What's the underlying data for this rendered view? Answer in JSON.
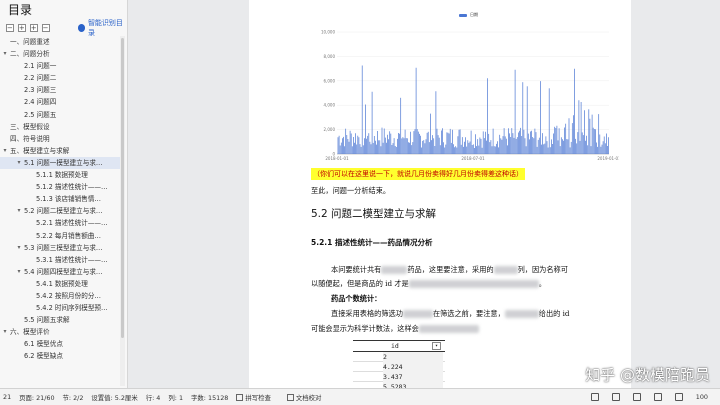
{
  "toc": {
    "title": "目录",
    "smart_toc_label": "智能识别目录",
    "items": [
      {
        "label": "一、问题重述",
        "level": 1,
        "arrow": ""
      },
      {
        "label": "二、问题分析",
        "level": 1,
        "arrow": "▾"
      },
      {
        "label": "2.1 问题一",
        "level": 2,
        "arrow": ""
      },
      {
        "label": "2.2 问题二",
        "level": 2,
        "arrow": ""
      },
      {
        "label": "2.3 问题三",
        "level": 2,
        "arrow": ""
      },
      {
        "label": "2.4 问题四",
        "level": 2,
        "arrow": ""
      },
      {
        "label": "2.5 问题五",
        "level": 2,
        "arrow": ""
      },
      {
        "label": "三、模型假设",
        "level": 1,
        "arrow": ""
      },
      {
        "label": "四、符号说明",
        "level": 1,
        "arrow": ""
      },
      {
        "label": "五、模型建立与求解",
        "level": 1,
        "arrow": "▾"
      },
      {
        "label": "5.1 问题一模型建立与求…",
        "level": 2,
        "arrow": "▾",
        "selected": true
      },
      {
        "label": "5.1.1 数据预处理",
        "level": 3,
        "arrow": ""
      },
      {
        "label": "5.1.2 描述性统计——…",
        "level": 3,
        "arrow": ""
      },
      {
        "label": "5.1.3 该店铺销售情…",
        "level": 3,
        "arrow": ""
      },
      {
        "label": "5.2 问题二模型建立与求…",
        "level": 2,
        "arrow": "▾"
      },
      {
        "label": "5.2.1 描述性统计——…",
        "level": 3,
        "arrow": ""
      },
      {
        "label": "5.2.2 每月销售额曲…",
        "level": 3,
        "arrow": ""
      },
      {
        "label": "5.3 问题三模型建立与求…",
        "level": 2,
        "arrow": "▾"
      },
      {
        "label": "5.3.1 描述性统计——…",
        "level": 3,
        "arrow": ""
      },
      {
        "label": "5.4 问题四模型建立与求…",
        "level": 2,
        "arrow": "▾"
      },
      {
        "label": "5.4.1 数据预处理",
        "level": 3,
        "arrow": ""
      },
      {
        "label": "5.4.2 按照月份的分…",
        "level": 3,
        "arrow": ""
      },
      {
        "label": "5.4.2 时间序列模型预…",
        "level": 3,
        "arrow": ""
      },
      {
        "label": "5.5 问题五求解",
        "level": 2,
        "arrow": ""
      },
      {
        "label": "六、模型评价",
        "level": 1,
        "arrow": "▾"
      },
      {
        "label": "6.1 模型优点",
        "level": 2,
        "arrow": ""
      },
      {
        "label": "6.2 模型缺点",
        "level": 2,
        "arrow": ""
      }
    ]
  },
  "document": {
    "highlight_note": "（你们可以在这里说一下，就说几月份卖得好几月份卖得差这种话）",
    "conclusion": "至此，问题一分析结束。",
    "section_heading": "5.2 问题二模型建立与求解",
    "subsection_heading": "5.2.1 描述性统计——药品情况分析",
    "para1_a": "本问要统计共有",
    "para1_b": "药品，这里要注意，采用的",
    "para1_c": "列，因为名称可",
    "para2_a": "以随便起，但是商品的 id 才是",
    "para2_b": "。",
    "bold_label": "药品个数统计：",
    "para3_a": "直接采用表格的筛选功",
    "para3_b": "在筛选之前，要注意，",
    "para3_c": "给出的 id",
    "para4_a": "可能会显示为科学计数法，这样会",
    "table_header": "id",
    "table_rows": [
      "2",
      "4.224",
      "3.437",
      "5.5283"
    ],
    "watermark": "知乎 @数模陪跑员"
  },
  "chart_data": {
    "type": "line",
    "series": [
      {
        "name": "日期",
        "color": "#4a76d3"
      }
    ],
    "y_ticks": [
      "10,000",
      "8,000",
      "6,000",
      "4,000",
      "2,000",
      "0"
    ],
    "x_ticks": [
      "2018-01-01",
      "2018-07-01",
      "2019-01-01"
    ],
    "ylim": [
      0,
      10000
    ]
  },
  "status": {
    "page_num": "21",
    "page_total": "页面: 21/60",
    "section": "节: 2/2",
    "setting": "设置值: 5.2厘米",
    "row": "行: 4",
    "col": "列: 1",
    "words": "字数: 15128",
    "spell": "拼写检查",
    "doc_check": "文档校对",
    "zoom": "100"
  }
}
